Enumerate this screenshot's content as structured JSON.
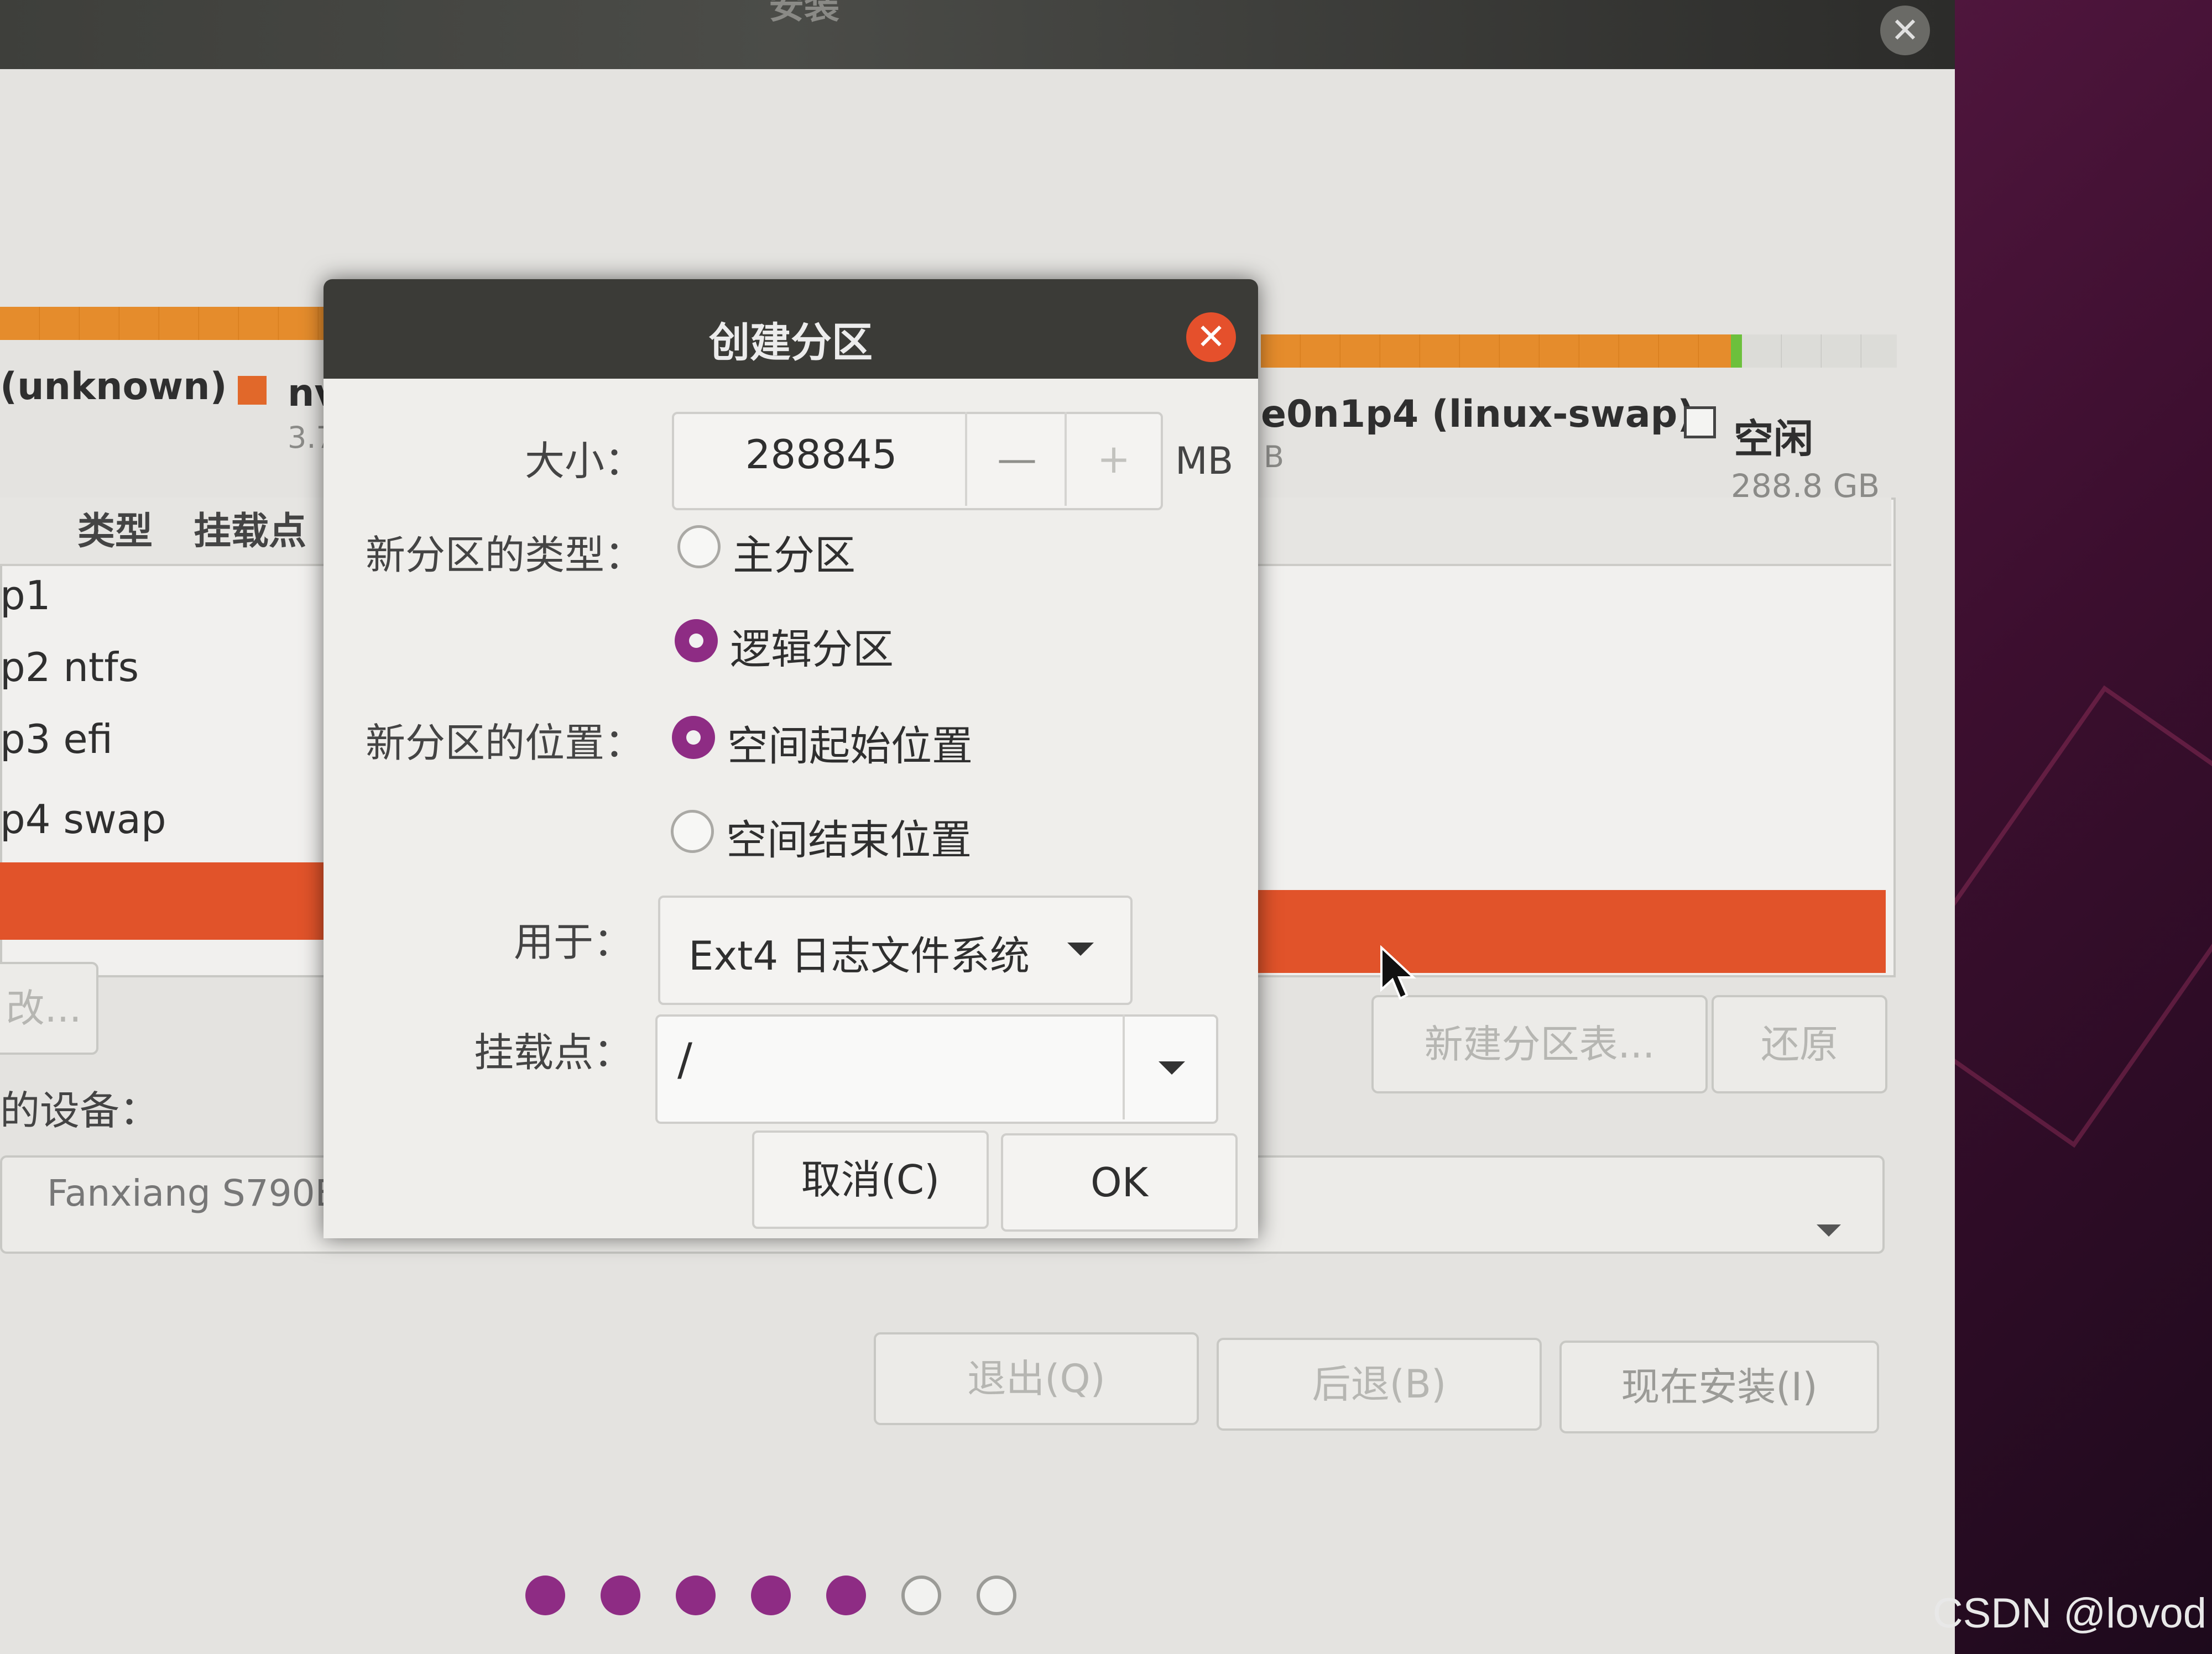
{
  "installer": {
    "title": "安装",
    "legend": {
      "unknown": "(unknown)",
      "nv_label": "nv",
      "nv_size": "3.7",
      "swap_label": "e0n1p4 (linux-swap)",
      "swap_size": "B",
      "free_label": "空闲",
      "free_size": "288.8 GB"
    },
    "table": {
      "col_type": "类型",
      "col_mount": "挂载点",
      "rows": [
        {
          "name": "p1",
          "type": ""
        },
        {
          "name": "p2",
          "type": "ntfs"
        },
        {
          "name": "p3",
          "type": "efi"
        },
        {
          "name": "p4",
          "type": "swap"
        }
      ]
    },
    "buttons": {
      "change": "改...",
      "new_table": "新建分区表...",
      "revert": "还原",
      "quit": "退出(Q)",
      "back": "后退(B)",
      "install": "现在安装(I)"
    },
    "device_label": "的设备：",
    "device_value": "Fanxiang S790E",
    "progress": {
      "total": 7,
      "completed": 5
    }
  },
  "dialog": {
    "title": "创建分区",
    "size_label": "大小：",
    "size_value": "288845",
    "size_minus": "—",
    "size_plus": "+",
    "size_unit": "MB",
    "type_label": "新分区的类型：",
    "type_primary": "主分区",
    "type_logical": "逻辑分区",
    "location_label": "新分区的位置：",
    "location_start": "空间起始位置",
    "location_end": "空间结束位置",
    "use_label": "用于：",
    "use_value": "Ext4 日志文件系统",
    "mount_label": "挂载点：",
    "mount_value": "/",
    "cancel": "取消(C)",
    "ok": "OK"
  },
  "watermark": "CSDN @lovod",
  "colors": {
    "accent": "#8e2c84",
    "selection": "#e1532a",
    "close_button": "#e5502c"
  }
}
